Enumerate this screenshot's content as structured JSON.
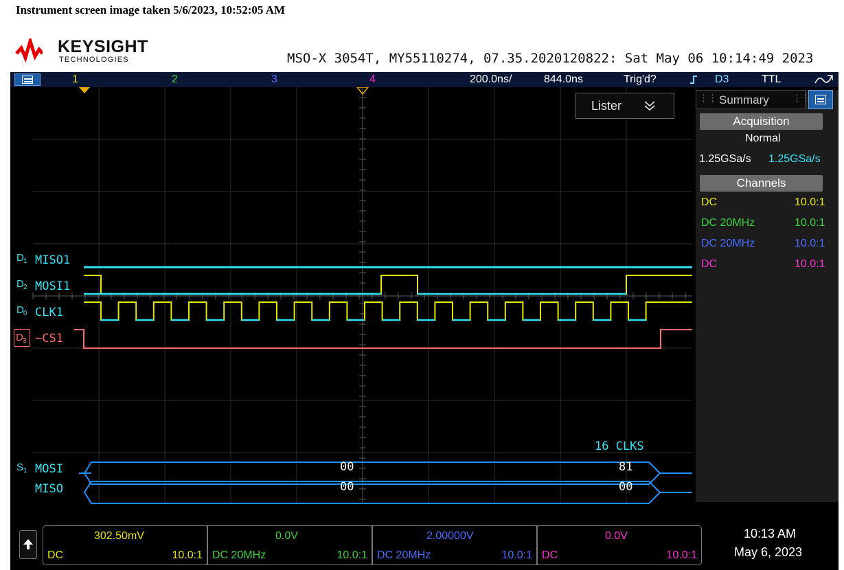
{
  "capture_title": "Instrument screen image taken 5/6/2023, 10:52:05 AM",
  "brand": {
    "name": "KEYSIGHT",
    "sub": "TECHNOLOGIES",
    "logo_color": "#e60000"
  },
  "device_line": "MSO-X 3054T, MY55110274, 07.35.2020120822: Sat May 06 10:14:49 2023",
  "topbar": {
    "menu_icon": "menu-icon",
    "channels": [
      {
        "label": "1",
        "color": "#e8e800"
      },
      {
        "label": "2",
        "color": "#3bd13b"
      },
      {
        "label": "3",
        "color": "#4a6cff"
      },
      {
        "label": "4",
        "color": "#ff2fd0"
      }
    ],
    "timebase": "200.0ns/",
    "delay": "844.0ns",
    "trigger_status": "Trig'd?",
    "trigger_source": "D3",
    "trigger_level": "TTL"
  },
  "right_panel": {
    "tab_label": "Summary",
    "acquisition_header": "Acquisition",
    "acquisition_mode": "Normal",
    "sample_rate_1": "1.25GSa/s",
    "sample_rate_2": "1.25GSa/s",
    "channels_header": "Channels",
    "channel_rows": [
      {
        "coupling": "DC",
        "probe": "10.0:1",
        "color": "#e8e800"
      },
      {
        "coupling": "DC  20MHz",
        "probe": "10.0:1",
        "color": "#3bd13b"
      },
      {
        "coupling": "DC  20MHz",
        "probe": "10.0:1",
        "color": "#4a6cff"
      },
      {
        "coupling": "DC",
        "probe": "10.0:1",
        "color": "#ff2fd0"
      }
    ]
  },
  "lister": {
    "label": "Lister"
  },
  "digital": [
    {
      "channel": "D",
      "index": "1",
      "name": "MISO1"
    },
    {
      "channel": "D",
      "index": "2",
      "name": "MOSI1"
    },
    {
      "channel": "D",
      "index": "0",
      "name": "CLK1"
    },
    {
      "channel": "D",
      "index": "3",
      "name": "~CS1"
    }
  ],
  "serial": {
    "bus": "S",
    "bus_index": "1",
    "clock_count": "16 CLKS",
    "rows": [
      {
        "name": "MOSI",
        "value_a": "00",
        "value_b": "81"
      },
      {
        "name": "MISO",
        "value_a": "00",
        "value_b": "00"
      }
    ]
  },
  "bottom_channels": [
    {
      "value": "302.50mV",
      "coupling": "DC",
      "probe": "10.0:1",
      "color": "#e8e800"
    },
    {
      "value": "0.0V",
      "coupling": "DC 20MHz",
      "probe": "10.0:1",
      "color": "#3bd13b"
    },
    {
      "value": "2.00000V",
      "coupling": "DC 20MHz",
      "probe": "10.0:1",
      "color": "#4a6cff"
    },
    {
      "value": "0.0V",
      "coupling": "DC",
      "probe": "10.0:1",
      "color": "#ff2fd0"
    }
  ],
  "clock": {
    "time": "10:13 AM",
    "date": "May 6, 2023"
  }
}
